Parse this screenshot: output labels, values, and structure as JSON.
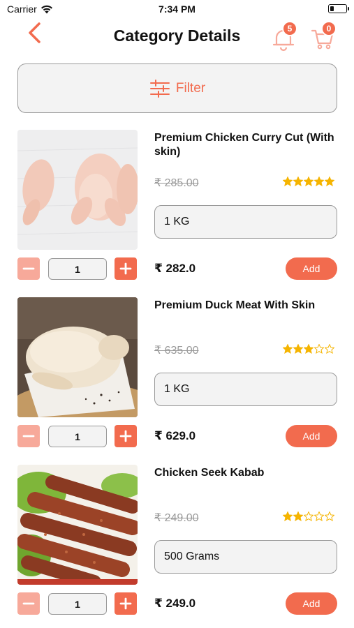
{
  "status_bar": {
    "carrier": "Carrier",
    "time": "7:34 PM"
  },
  "header": {
    "title": "Category Details",
    "notification_count": "5",
    "cart_count": "0"
  },
  "filter": {
    "label": "Filter"
  },
  "accent_color": "#f26b4e",
  "star_color": "#f5b400",
  "products": [
    {
      "name": "Premium Chicken Curry Cut (With skin)",
      "old_price": "₹ 285.00",
      "rating": 5,
      "unit": "1 KG",
      "quantity": "1",
      "price": "₹ 282.0",
      "add_label": "Add",
      "image": "raw-whole-chicken-photo"
    },
    {
      "name": "Premium Duck Meat With Skin",
      "old_price": "₹ 635.00",
      "rating": 3,
      "unit": "1 KG",
      "quantity": "1",
      "price": "₹ 629.0",
      "add_label": "Add",
      "image": "raw-duck-photo"
    },
    {
      "name": "Chicken Seek Kabab",
      "old_price": "₹ 249.00",
      "rating": 2,
      "unit": "500 Grams",
      "quantity": "1",
      "price": "₹ 249.0",
      "add_label": "Add",
      "image": "seekh-kabab-photo"
    }
  ]
}
